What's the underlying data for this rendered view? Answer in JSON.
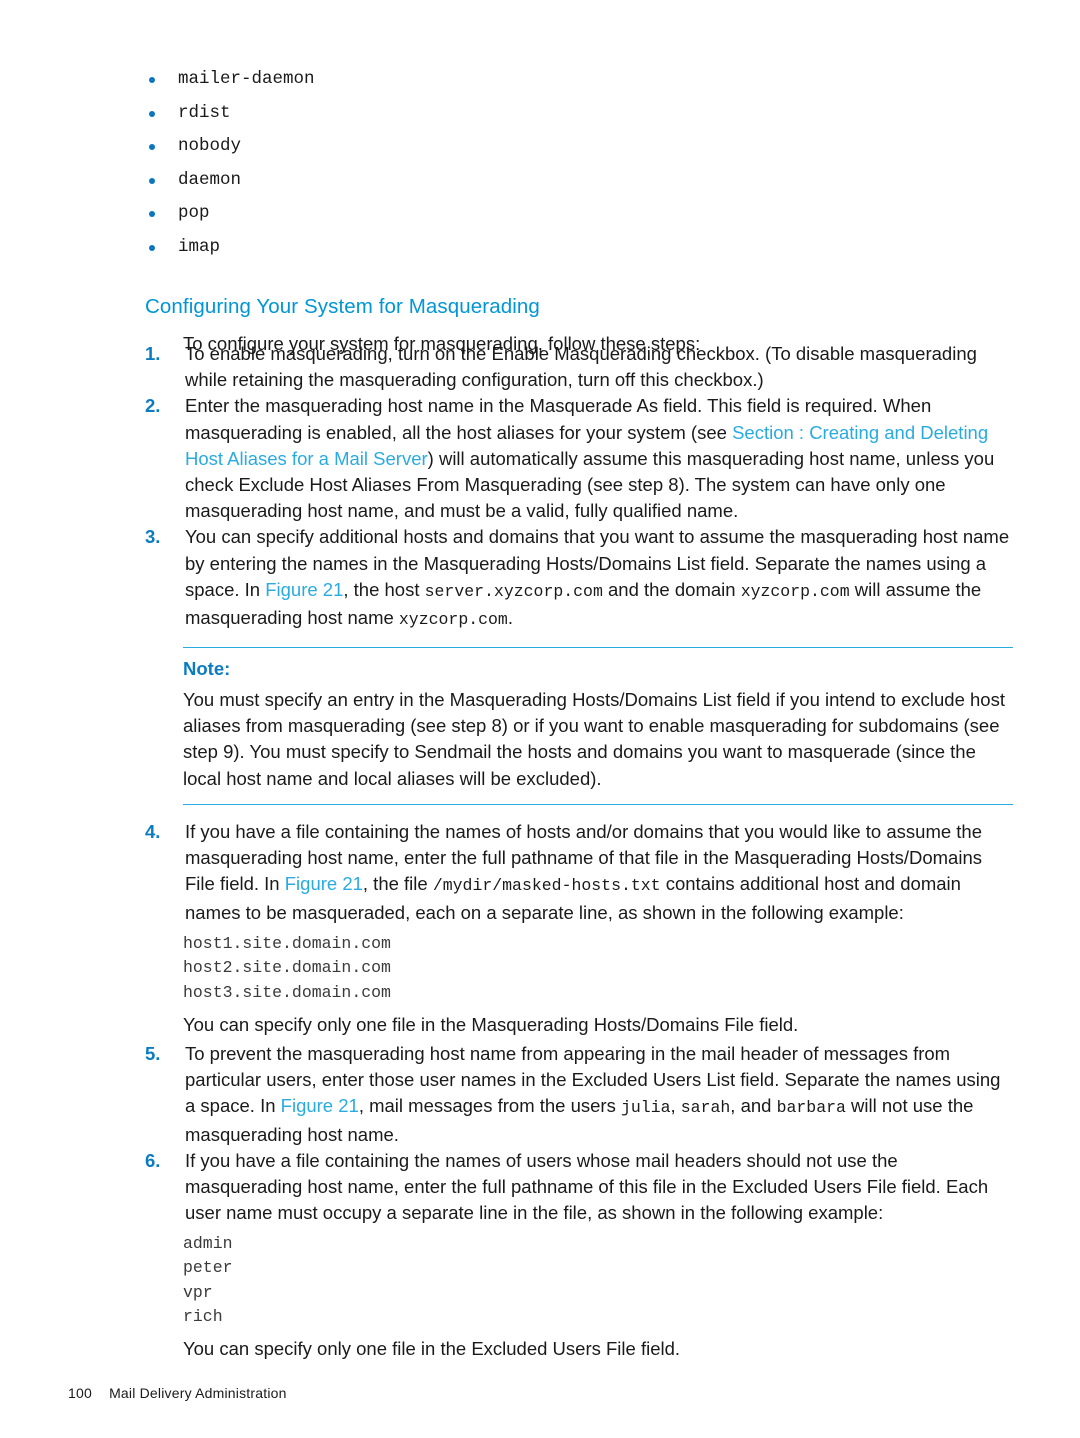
{
  "colors": {
    "heading": "#0096D6",
    "link": "#29ABE2",
    "number": "#0B7CC2",
    "bullet": "#0B76BD",
    "rule": "#29ABE2",
    "text": "#1A1A1A"
  },
  "bullet_list": [
    {
      "label": "mailer-daemon"
    },
    {
      "label": "rdist"
    },
    {
      "label": "nobody"
    },
    {
      "label": "daemon"
    },
    {
      "label": "pop"
    },
    {
      "label": "imap"
    }
  ],
  "section": {
    "heading": "Configuring Your System for Masquerading",
    "intro": "To configure your system for masquerading, follow these steps:"
  },
  "steps": [
    {
      "number": "1.",
      "parts": [
        {
          "type": "text",
          "value": "To enable masquerading, turn on the Enable Masquerading checkbox. (To disable masquerading while retaining the masquerading configuration, turn off this checkbox.)"
        }
      ]
    },
    {
      "number": "2.",
      "parts": [
        {
          "type": "text",
          "value": "Enter the masquerading host name in the Masquerade As field. This field is required. When masquerading is enabled, all the host aliases for your system (see "
        },
        {
          "type": "link",
          "value": "Section : Creating and Deleting Host Aliases for a Mail Server"
        },
        {
          "type": "text",
          "value": ") will automatically assume this masquerading host name, unless you check Exclude Host Aliases From Masquerading (see step 8). The system can have only one masquerading host name, and must be a valid, fully qualified name."
        }
      ]
    },
    {
      "number": "3.",
      "parts": [
        {
          "type": "text",
          "value": "You can specify additional hosts and domains that you want to assume the masquerading host name by entering the names in the Masquerading Hosts/Domains List field. Separate the names using a space. In "
        },
        {
          "type": "link",
          "value": "Figure 21"
        },
        {
          "type": "text",
          "value": ", the host "
        },
        {
          "type": "mono",
          "value": "server.xyzcorp.com"
        },
        {
          "type": "text",
          "value": " and the domain "
        },
        {
          "type": "mono",
          "value": "xyzcorp.com"
        },
        {
          "type": "text",
          "value": " will assume the masquerading host name "
        },
        {
          "type": "mono",
          "value": "xyzcorp.com"
        },
        {
          "type": "text",
          "value": "."
        }
      ]
    }
  ],
  "note": {
    "label": "Note:",
    "body": "You must specify an entry in the Masquerading Hosts/Domains List field if you intend to exclude host aliases from masquerading (see step 8) or if you want to enable masquerading for subdomains (see step 9). You must specify to Sendmail the hosts and domains you want to masquerade (since the local host name and local aliases will be excluded)."
  },
  "steps_after_note": [
    {
      "number": "4.",
      "parts": [
        {
          "type": "text",
          "value": "If you have a file containing the names of hosts and/or domains that you would like to assume the masquerading host name, enter the full pathname of that file in the Masquerading Hosts/Domains File field. In "
        },
        {
          "type": "link",
          "value": "Figure 21"
        },
        {
          "type": "text",
          "value": ", the file "
        },
        {
          "type": "mono",
          "value": "/mydir/masked-hosts.txt"
        },
        {
          "type": "text",
          "value": " contains additional host and domain names to be masqueraded, each on a separate line, as shown in the following example:"
        }
      ]
    }
  ],
  "code_block_hosts": "host1.site.domain.com\nhost2.site.domain.com\nhost3.site.domain.com",
  "after_hosts_text": "You can specify only one file in the Masquerading Hosts/Domains File field.",
  "steps_tail": [
    {
      "number": "5.",
      "parts": [
        {
          "type": "text",
          "value": "To prevent the masquerading host name from appearing in the mail header of messages from particular users, enter those user names in the Excluded Users List field. Separate the names using a space. In "
        },
        {
          "type": "link",
          "value": "Figure 21"
        },
        {
          "type": "text",
          "value": ", mail messages from the users "
        },
        {
          "type": "mono",
          "value": "julia"
        },
        {
          "type": "text",
          "value": ", "
        },
        {
          "type": "mono",
          "value": "sarah"
        },
        {
          "type": "text",
          "value": ", and "
        },
        {
          "type": "mono",
          "value": "barbara"
        },
        {
          "type": "text",
          "value": " will not use the masquerading host name."
        }
      ]
    },
    {
      "number": "6.",
      "parts": [
        {
          "type": "text",
          "value": "If you have a file containing the names of users whose mail headers should not use the masquerading host name, enter the full pathname of this file in the Excluded Users File field. Each user name must occupy a separate line in the file, as shown in the following example:"
        }
      ]
    }
  ],
  "code_block_users": "admin\npeter\nvpr\nrich",
  "after_users_text": "You can specify only one file in the Excluded Users File field.",
  "footer": {
    "page_number": "100",
    "title": "Mail Delivery Administration"
  }
}
